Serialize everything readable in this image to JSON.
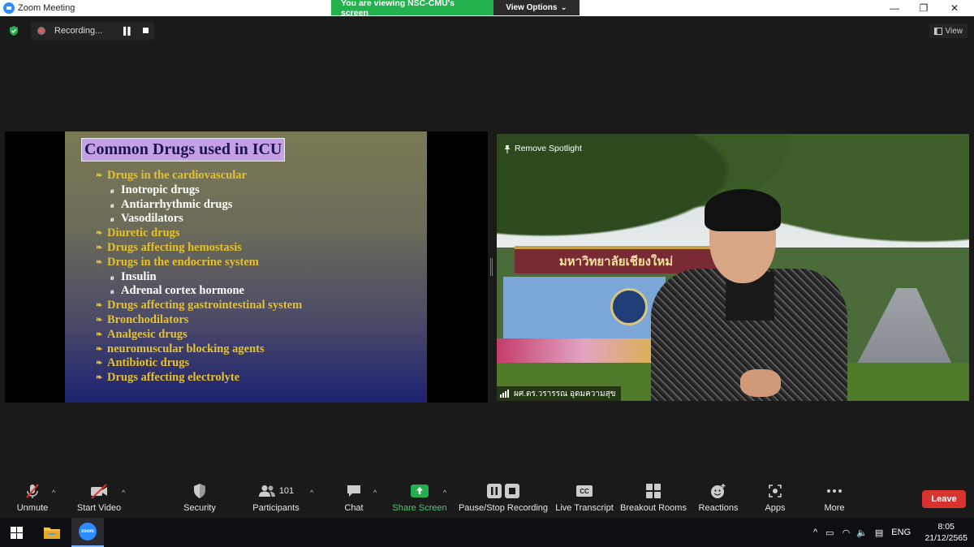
{
  "window": {
    "title": "Zoom Meeting",
    "share_banner": "You are viewing NSC-CMU's screen",
    "view_options": "View Options",
    "minimize": "—",
    "restore": "❐",
    "close": "✕"
  },
  "recording": {
    "label": "Recording..."
  },
  "view_button": "View",
  "slide": {
    "title": "Common Drugs used in ICU",
    "items": [
      {
        "level": 1,
        "text": "Drugs in the cardiovascular"
      },
      {
        "level": 2,
        "text": "Inotropic drugs"
      },
      {
        "level": 2,
        "text": "Antiarrhythmic drugs"
      },
      {
        "level": 2,
        "text": "Vasodilators"
      },
      {
        "level": 1,
        "text": "Diuretic drugs"
      },
      {
        "level": 1,
        "text": "Drugs affecting hemostasis"
      },
      {
        "level": 1,
        "text": "Drugs in the endocrine system"
      },
      {
        "level": 2,
        "text": " Insulin"
      },
      {
        "level": 2,
        "text": " Adrenal cortex hormone"
      },
      {
        "level": 1,
        "text": "Drugs affecting gastrointestinal system"
      },
      {
        "level": 1,
        "text": "Bronchodilators"
      },
      {
        "level": 1,
        "text": "Analgesic drugs"
      },
      {
        "level": 1,
        "text": "neuromuscular blocking agents"
      },
      {
        "level": 1,
        "text": "Antibiotic drugs"
      },
      {
        "level": 1,
        "text": "Drugs affecting electrolyte"
      }
    ]
  },
  "video": {
    "remove_spotlight": "Remove Spotlight",
    "participant_name": "ผศ.ดร.วรารรณ อุดมความสุข",
    "gate_text": "มหาวิทยาลัยเชียงใหม่"
  },
  "toolbar": {
    "unmute": "Unmute",
    "start_video": "Start Video",
    "security": "Security",
    "participants": "Participants",
    "participant_count": "101",
    "chat": "Chat",
    "share_screen": "Share Screen",
    "pause_stop_recording": "Pause/Stop Recording",
    "live_transcript": "Live Transcript",
    "cc_badge": "CC",
    "breakout_rooms": "Breakout Rooms",
    "reactions": "Reactions",
    "apps": "Apps",
    "more": "More",
    "leave": "Leave"
  },
  "taskbar": {
    "zoom_badge": "zoom",
    "language": "ENG",
    "time": "8:05",
    "date": "21/12/2565"
  },
  "colors": {
    "accent_green": "#23b14d",
    "leave_red": "#d9332f",
    "slide_yellow": "#e6c12a",
    "title_lilac": "#c6a0e6"
  }
}
